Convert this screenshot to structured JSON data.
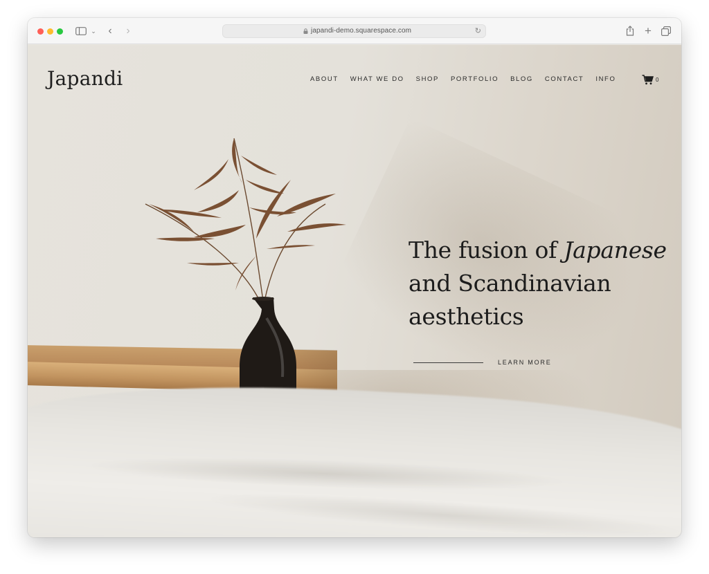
{
  "browser": {
    "url": "japandi-demo.squarespace.com"
  },
  "site": {
    "logo": "Japandi",
    "nav": [
      "ABOUT",
      "WHAT WE DO",
      "SHOP",
      "PORTFOLIO",
      "BLOG",
      "CONTACT",
      "INFO"
    ],
    "cart_count": "0"
  },
  "hero": {
    "headline_1": "The fusion of ",
    "headline_em": "Japanese",
    "headline_2": "and Scandinavian",
    "headline_3": "aesthetics",
    "cta_label": "LEARN MORE"
  },
  "icons": {
    "toolbar": [
      "sidebar-icon",
      "chevron-down-icon",
      "back-icon",
      "forward-icon",
      "lock-icon",
      "reload-icon",
      "share-icon",
      "plus-icon",
      "tabs-icon"
    ],
    "site": [
      "cart-icon"
    ]
  },
  "colors": {
    "text": "#1c1c1c",
    "background": "#e6e3dc",
    "traffic_red": "#ff5f57",
    "traffic_yellow": "#febc2e",
    "traffic_green": "#28c840"
  }
}
